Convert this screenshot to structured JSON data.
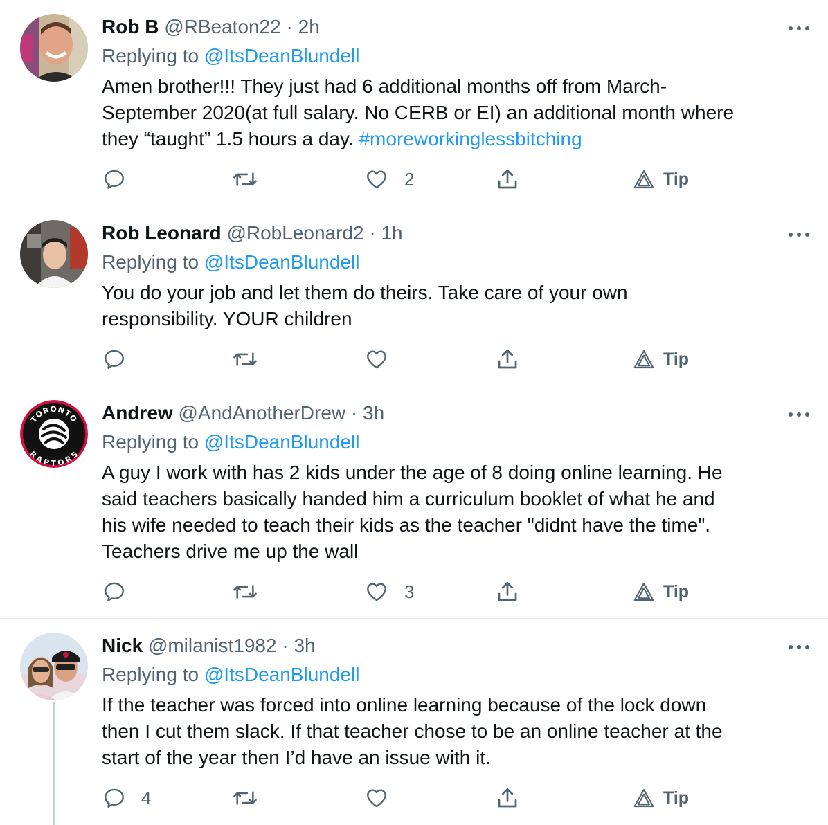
{
  "tweets": [
    {
      "name": "Rob B",
      "handle": "@RBeaton22",
      "time": "· 2h",
      "replying_prefix": "Replying to ",
      "replying_to": "@ItsDeanBlundell",
      "lines": [
        "Amen brother!!! They just had 6 additional months off from March-",
        "September 2020(at full salary. No CERB or EI) an additional month where",
        "they “taught” 1.5 hours a day.  "
      ],
      "hashtag": "#moreworkinglessbitching",
      "reply_count": "",
      "like_count": "2",
      "tip_label": "Tip"
    },
    {
      "name": "Rob Leonard",
      "handle": "@RobLeonard2",
      "time": "· 1h",
      "replying_prefix": "Replying to ",
      "replying_to": "@ItsDeanBlundell",
      "lines": [
        "You do your job and let them do theirs. Take care of your own",
        "responsibility. YOUR children"
      ],
      "reply_count": "",
      "like_count": "",
      "tip_label": "Tip"
    },
    {
      "name": "Andrew",
      "handle": "@AndAnotherDrew",
      "time": "· 3h",
      "replying_prefix": "Replying to ",
      "replying_to": "@ItsDeanBlundell",
      "lines": [
        "A guy I work with has 2 kids under the age of 8 doing online learning.  He",
        "said teachers basically handed him a curriculum booklet of what he and",
        "his wife needed to teach their kids as the teacher \"didnt have the time\".",
        "Teachers drive me up the wall"
      ],
      "avatar_logo_top": "TORONTO",
      "avatar_logo_bottom": "RAPTORS",
      "reply_count": "",
      "like_count": "3",
      "tip_label": "Tip"
    },
    {
      "name": "Nick",
      "handle": "@milanist1982",
      "time": "· 3h",
      "replying_prefix": "Replying to ",
      "replying_to": "@ItsDeanBlundell",
      "lines": [
        "If the teacher was forced into online learning  because of the lock down",
        "then I cut them slack. If that teacher chose to be an online teacher at the",
        "start of the year then I’d have an issue with it."
      ],
      "reply_count": "4",
      "like_count": "",
      "tip_label": "Tip"
    }
  ],
  "icons": {
    "reply": "reply-icon",
    "retweet": "retweet-icon",
    "like": "heart-icon",
    "share": "share-icon",
    "tip": "tip-icon",
    "more": "more-icon"
  },
  "colors": {
    "link": "#1d9bf0",
    "secondary_text": "#536471",
    "divider": "#e6ecf0"
  }
}
